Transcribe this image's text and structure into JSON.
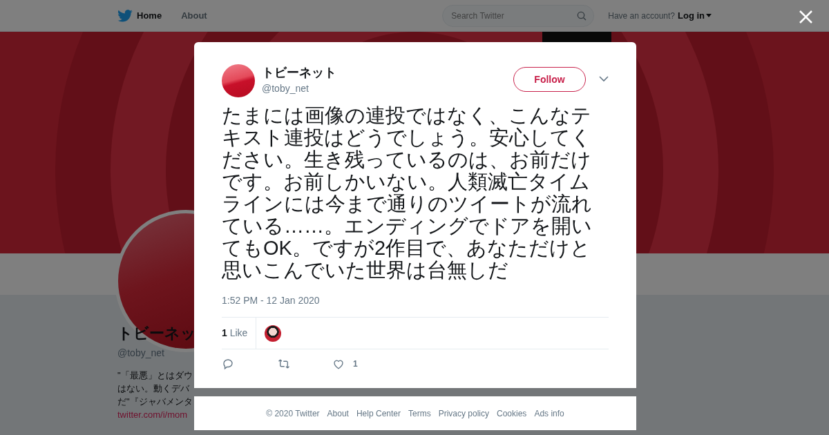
{
  "nav": {
    "items": [
      {
        "label": "Home",
        "selected": true
      },
      {
        "label": "About",
        "selected": false
      }
    ],
    "search": {
      "placeholder": "Search Twitter"
    },
    "account_prompt": "Have an account?",
    "login": "Log in"
  },
  "profile": {
    "name": "トビーネッ",
    "handle": "@toby_net",
    "bio_lines": [
      "\"「最悪」とはダウ",
      "はない。動くデバ",
      "だ\"『ジャバメンタ"
    ],
    "link": "twitter.com/i/mom"
  },
  "tweet": {
    "name": "トビーネット",
    "handle": "@toby_net",
    "follow": "Follow",
    "text": "たまには画像の連投ではなく、こんなテキスト連投はどうでしょう。安心してください。生き残っているのは、お前だけです。お前しかいない。人類滅亡タイムラインには今まで通りのツイートが流れている……。エンディングでドアを開いてもOK。ですが2作目で、あなただけと思いこんでいた世界は台無しだ",
    "time": "1:52 PM - 12 Jan 2020",
    "likes_count": "1",
    "likes_label": "Like",
    "actions": [
      {
        "kind": "reply"
      },
      {
        "kind": "retweet"
      },
      {
        "kind": "like",
        "count": "1"
      }
    ]
  },
  "footer": [
    "© 2020 Twitter",
    "About",
    "Help Center",
    "Terms",
    "Privacy policy",
    "Cookies",
    "Ads info"
  ]
}
